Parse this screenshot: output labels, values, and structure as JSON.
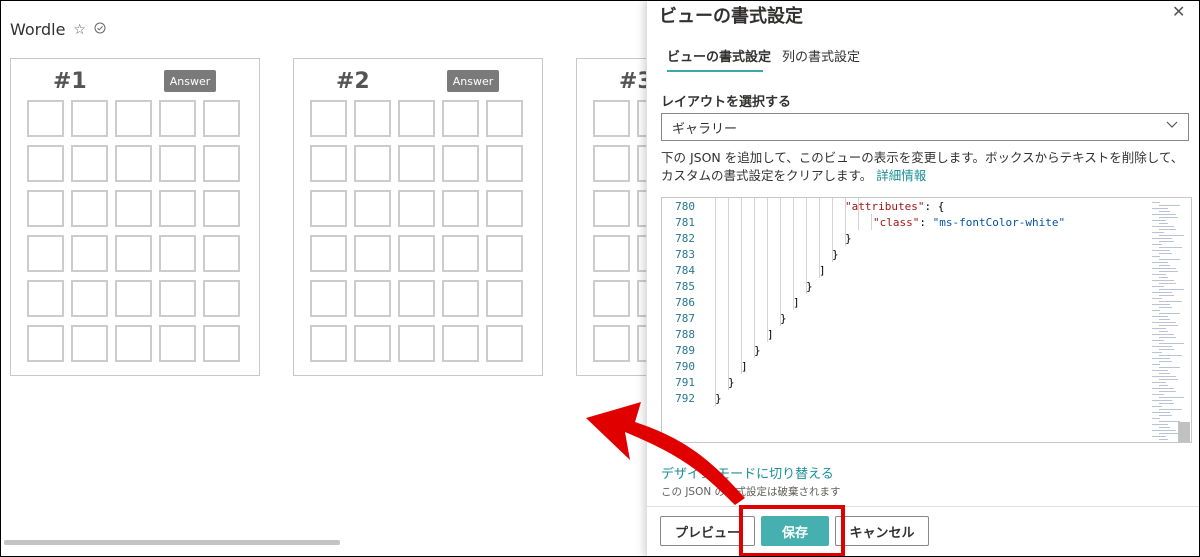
{
  "list": {
    "title": "Wordle",
    "star_icon": "☆",
    "check_icon": "✓",
    "cards": [
      {
        "number": "#1",
        "answer_label": "Answer"
      },
      {
        "number": "#2",
        "answer_label": "Answer"
      },
      {
        "number": "#3",
        "answer_label": ""
      }
    ]
  },
  "pane": {
    "title": "ビューの書式設定",
    "close_icon": "✕",
    "tabs": [
      {
        "label": "ビューの書式設定"
      },
      {
        "label": "列の書式設定"
      }
    ],
    "layout_label": "レイアウトを選択する",
    "layout_value": "ギャラリー",
    "description": "下の JSON を追加して、このビューの表示を変更します。ボックスからテキストを削除して、カスタムの書式設定をクリアします。",
    "details_link": "詳細情報",
    "code": {
      "line_numbers": [
        "780",
        "781",
        "782",
        "783",
        "784",
        "785",
        "786",
        "787",
        "788",
        "789",
        "790",
        "791",
        "792"
      ],
      "line_780_key": "\"attributes\"",
      "line_780_rest": ": {",
      "line_781_key": "\"class\"",
      "line_781_colon": ": ",
      "line_781_value": "\"ms-fontColor-white\"",
      "line_782": "}",
      "line_783": "}",
      "line_784": "]",
      "line_785": "}",
      "line_786": "]",
      "line_787": "}",
      "line_788": "]",
      "line_789": "}",
      "line_790": "]",
      "line_791": "}",
      "line_792": "}"
    },
    "switch_link": "デザイン モードに切り替える",
    "warning": "この JSON の書式設定は破棄されます",
    "buttons": {
      "preview": "プレビュー",
      "save": "保存",
      "cancel": "キャンセル"
    }
  },
  "colors": {
    "accent": "#46b0b0",
    "link": "#1a8f95",
    "highlight": "#e00000"
  }
}
